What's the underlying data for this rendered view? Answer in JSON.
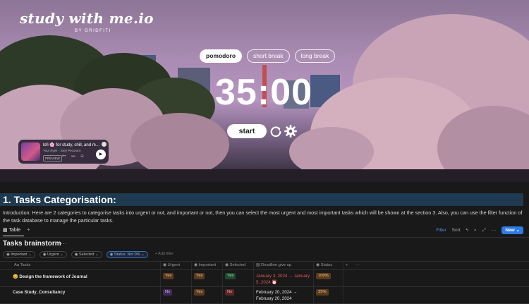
{
  "logo": {
    "main": "study with me.io",
    "sub": "BY GRIDFITI"
  },
  "timer": {
    "modes": [
      "pomodoro",
      "short break",
      "long break"
    ],
    "active_mode": "pomodoro",
    "time": "35:00",
    "start_label": "start"
  },
  "player": {
    "title": "lofi 🌸 for study, chill, and m…",
    "artist": "Your Eyes · Joey Pecoraro",
    "preview_label": "PREVIEW"
  },
  "doc": {
    "heading": "1. Tasks Categorisation:",
    "intro": "Introduction: Here are 2 categories to categorise tasks into urgent or not, and important or not, then you can select the most urgent and most important tasks which will be shown at the section 3. Also, you can use the filter function of the task database to manage the particular tasks."
  },
  "view": {
    "tab_label": "Table",
    "tools": {
      "filter": "Filter",
      "sort": "Sort",
      "new": "New"
    }
  },
  "database": {
    "title": "Tasks brainstorm",
    "filters": [
      "Important",
      "Urgent",
      "Selected",
      "Status: Not 0%"
    ],
    "add_filter": "+ Add filter",
    "columns": [
      "Tasks",
      "Urgent",
      "Important",
      "Selected",
      "Deadline give up",
      "Status"
    ],
    "rows": [
      {
        "task": "😊 Design the framework of Journal",
        "urgent": "Yes",
        "important": "Yes",
        "selected": "Yes",
        "deadline_1": "January 3, 2024 → January",
        "deadline_2": "5, 2024 ⏰",
        "deadline_late": true,
        "status": "100%"
      },
      {
        "task": "Case Study_Consultancy",
        "urgent": "No",
        "important": "Yes",
        "selected": "No",
        "deadline_1": "February 20, 2024 →",
        "deadline_2": "February 20, 2024",
        "deadline_late": false,
        "status": "25%"
      }
    ]
  }
}
